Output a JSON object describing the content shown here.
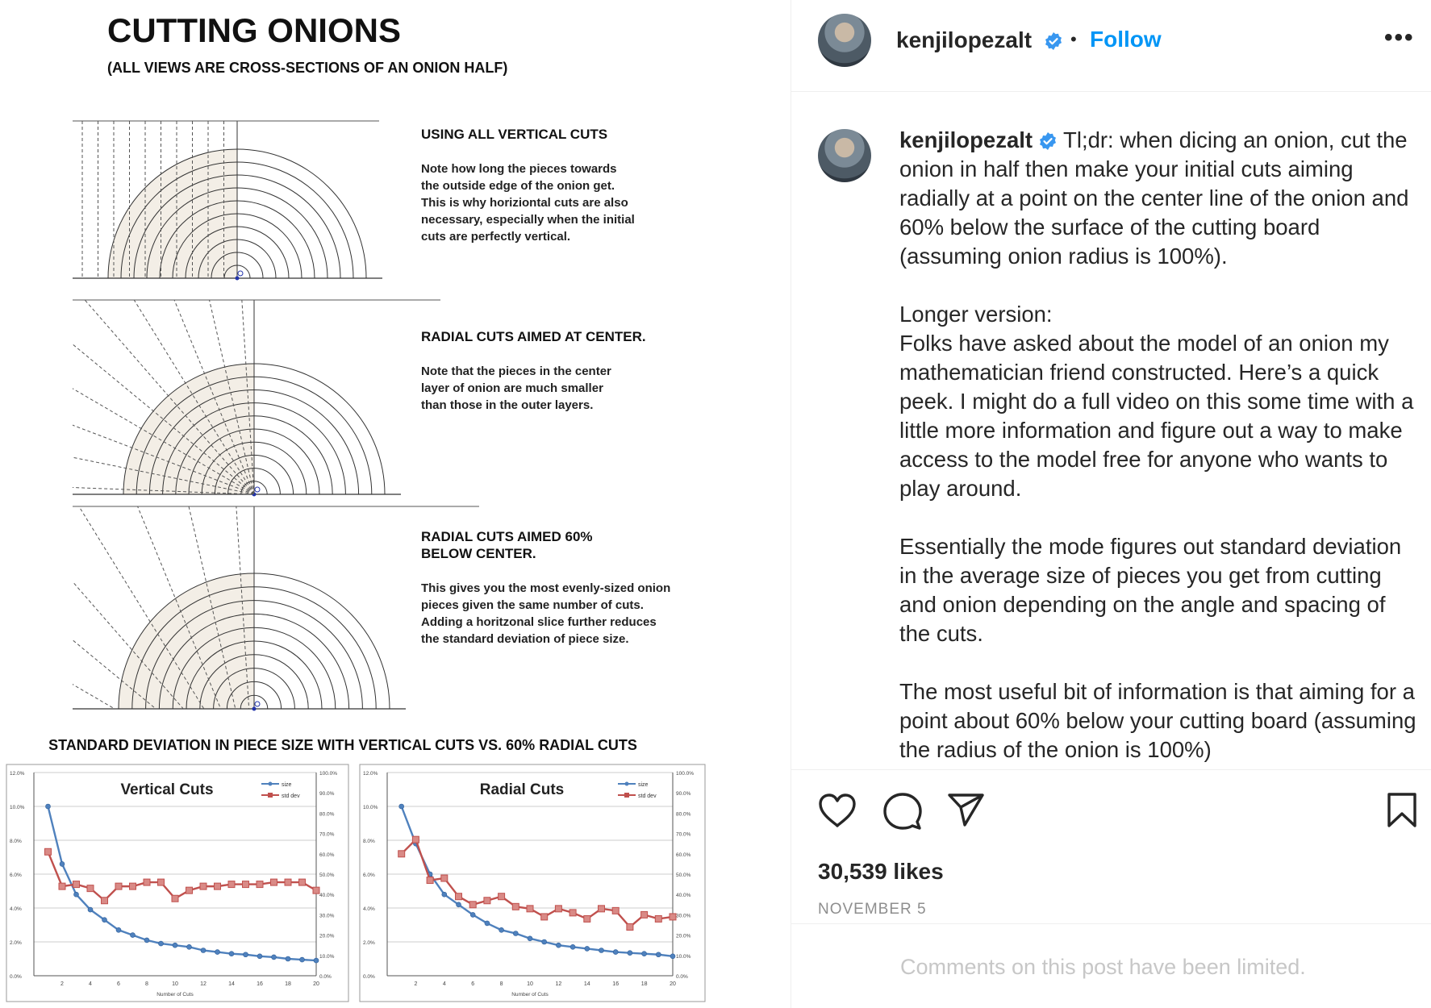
{
  "image": {
    "title": "CUTTING ONIONS",
    "subtitle": "(ALL VIEWS ARE CROSS-SECTIONS OF AN ONION HALF)",
    "panels": [
      {
        "heading": "USING ALL VERTICAL CUTS",
        "body": [
          "Note how long the pieces towards",
          "the outside edge of the onion get.",
          "This is why horiziontal cuts are also",
          "necessary, especially when the initial",
          "cuts are perfectly vertical."
        ]
      },
      {
        "heading": "RADIAL CUTS AIMED AT CENTER.",
        "body": [
          "Note that the pieces in the center",
          "layer of onion are much smaller",
          "than those in the outer layers."
        ]
      },
      {
        "heading": [
          "RADIAL CUTS AIMED 60%",
          "BELOW CENTER."
        ],
        "body": [
          "This gives you the most evenly-sized onion",
          "pieces given the same number of cuts.",
          "Adding a horitzonal slice further reduces",
          "the standard deviation of piece size."
        ]
      }
    ],
    "charts_heading": "STANDARD DEVIATION IN PIECE SIZE WITH VERTICAL CUTS VS. 60% RADIAL CUTS"
  },
  "chart_data": [
    {
      "type": "line",
      "title": "Vertical Cuts",
      "xlabel": "Number of Cuts",
      "x": [
        1,
        2,
        3,
        4,
        5,
        6,
        7,
        8,
        9,
        10,
        11,
        12,
        13,
        14,
        15,
        16,
        17,
        18,
        19,
        20
      ],
      "xticks": [
        "2",
        "4",
        "6",
        "8",
        "10",
        "12",
        "14",
        "16",
        "18",
        "20"
      ],
      "xlim": [
        0,
        20
      ],
      "ylim": [
        0,
        12
      ],
      "yticks_left": [
        "0.0%",
        "2.0%",
        "4.0%",
        "6.0%",
        "8.0%",
        "10.0%",
        "12.0%"
      ],
      "y2lim": [
        0,
        100
      ],
      "yticks_right": [
        "0.0%",
        "10.0%",
        "20.0%",
        "30.0%",
        "40.0%",
        "50.0%",
        "60.0%",
        "70.0%",
        "80.0%",
        "90.0%",
        "100.0%"
      ],
      "legend": "top-right",
      "grid": true,
      "series": [
        {
          "name": "size",
          "axis": "left",
          "color": "#4f81bd",
          "values": [
            10.0,
            6.6,
            4.8,
            3.9,
            3.3,
            2.7,
            2.4,
            2.1,
            1.9,
            1.8,
            1.7,
            1.5,
            1.4,
            1.3,
            1.25,
            1.15,
            1.1,
            1.0,
            0.95,
            0.9
          ]
        },
        {
          "name": "std dev",
          "axis": "right",
          "color": "#c0504d",
          "values": [
            61,
            44,
            45,
            43,
            37,
            44,
            44,
            46,
            46,
            38,
            42,
            44,
            44,
            45,
            45,
            45,
            46,
            46,
            46,
            42
          ]
        }
      ]
    },
    {
      "type": "line",
      "title": "Radial Cuts",
      "xlabel": "Number of Cuts",
      "x": [
        1,
        2,
        3,
        4,
        5,
        6,
        7,
        8,
        9,
        10,
        11,
        12,
        13,
        14,
        15,
        16,
        17,
        18,
        19,
        20
      ],
      "xticks": [
        "2",
        "4",
        "6",
        "8",
        "10",
        "12",
        "14",
        "16",
        "18",
        "20"
      ],
      "xlim": [
        0,
        20
      ],
      "ylim": [
        0,
        12
      ],
      "yticks_left": [
        "0.0%",
        "2.0%",
        "4.0%",
        "6.0%",
        "8.0%",
        "10.0%",
        "12.0%"
      ],
      "y2lim": [
        0,
        100
      ],
      "yticks_right": [
        "0.0%",
        "10.0%",
        "20.0%",
        "30.0%",
        "40.0%",
        "50.0%",
        "60.0%",
        "70.0%",
        "80.0%",
        "90.0%",
        "100.0%"
      ],
      "legend": "top-right",
      "grid": true,
      "series": [
        {
          "name": "size",
          "axis": "left",
          "color": "#4f81bd",
          "values": [
            10.0,
            7.8,
            6.0,
            4.8,
            4.2,
            3.6,
            3.1,
            2.7,
            2.5,
            2.2,
            2.0,
            1.8,
            1.7,
            1.6,
            1.5,
            1.4,
            1.35,
            1.3,
            1.25,
            1.15
          ]
        },
        {
          "name": "std dev",
          "axis": "right",
          "color": "#c0504d",
          "values": [
            60,
            67,
            47,
            48,
            39,
            35,
            37,
            39,
            34,
            33,
            29,
            33,
            31,
            28,
            33,
            32,
            24,
            30,
            28,
            29
          ]
        }
      ]
    }
  ],
  "sidebar": {
    "username": "kenjilopezalt",
    "separator": "•",
    "follow_label": "Follow",
    "more_label": "•••",
    "caption": {
      "username": "kenjilopezalt",
      "paragraphs": [
        "Tl;dr: when dicing an onion, cut the onion in half then make your initial cuts aiming radially at a point on the center line of the onion and 60% below the surface of the cutting board (assuming onion radius is 100%).",
        "Longer version:\nFolks have asked about the model of an onion my mathematician friend constructed. Here’s a quick peek. I might do a full video on this some time with a little more information and figure out a way to make access to the model free for anyone who wants to play around.",
        "Essentially the mode figures out standard deviation in the average size of pieces you get from cutting and onion depending on the angle and spacing of the cuts.",
        "The most useful bit of information is that aiming for a point about 60% below your cutting board (assuming the radius of the onion is 100%)"
      ]
    },
    "likes": "30,539 likes",
    "date": "NOVEMBER 5",
    "comments_limited": "Comments on this post have been limited."
  },
  "colors": {
    "accent": "#0095f6",
    "verified": "#3897f0",
    "text": "#262626",
    "muted": "#8e8e8e",
    "onion_fill": "#f3eee6"
  },
  "icons": [
    "verified-badge-icon",
    "heart-icon",
    "comment-icon",
    "share-icon",
    "bookmark-icon",
    "more-options-icon"
  ]
}
